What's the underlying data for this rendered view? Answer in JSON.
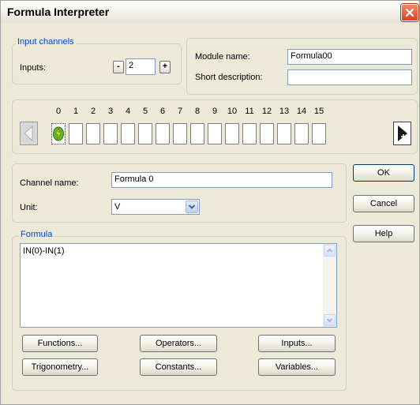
{
  "window": {
    "title": "Formula Interpreter"
  },
  "input_channels": {
    "legend": "Input channels",
    "inputs_label": "Inputs:",
    "decrement_label": "-",
    "inputs_value": "2",
    "increment_label": "+"
  },
  "module": {
    "name_label": "Module name:",
    "name_value": "Formula00",
    "short_desc_label": "Short description:",
    "short_desc_value": ""
  },
  "channel_strip": {
    "numbers": [
      "0",
      "1",
      "2",
      "3",
      "4",
      "5",
      "6",
      "7",
      "8",
      "9",
      "10",
      "11",
      "12",
      "13",
      "14",
      "15"
    ],
    "active_channel": 0
  },
  "channel": {
    "name_label": "Channel name:",
    "name_value": "Formula 0",
    "unit_label": "Unit:",
    "unit_value": "V"
  },
  "buttons": {
    "ok": "OK",
    "cancel": "Cancel",
    "help": "Help"
  },
  "formula": {
    "legend": "Formula",
    "text": "IN(0)-IN(1)",
    "functions": "Functions...",
    "operators": "Operators...",
    "inputs": "Inputs...",
    "trigonometry": "Trigonometry...",
    "constants": "Constants...",
    "variables": "Variables..."
  },
  "icons": {
    "close": "close-icon",
    "scroll_left": "arrow-left-icon",
    "scroll_right": "arrow-right-icon",
    "active_channel": "lightning-icon"
  },
  "colors": {
    "legend": "#0046d5",
    "background": "#ece9d8",
    "close": "#d9411c"
  }
}
